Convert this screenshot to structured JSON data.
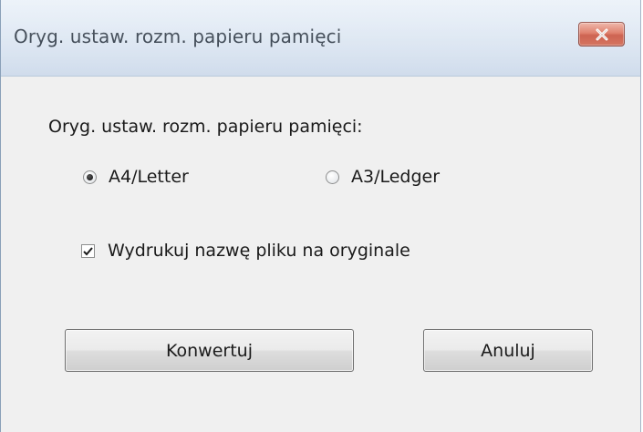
{
  "window": {
    "title": "Oryg. ustaw. rozm. papieru pamięci",
    "close_icon": "close-icon",
    "close_color": "#c7412b"
  },
  "dialog": {
    "group_label": "Oryg. ustaw. rozm. papieru pamięci:",
    "radios": [
      {
        "label": "A4/Letter",
        "checked": true
      },
      {
        "label": "A3/Ledger",
        "checked": false
      }
    ],
    "checkbox": {
      "label": "Wydrukuj nazwę pliku na oryginale",
      "checked": true
    },
    "buttons": {
      "convert_label": "Konwertuj",
      "cancel_label": "Anuluj"
    }
  }
}
